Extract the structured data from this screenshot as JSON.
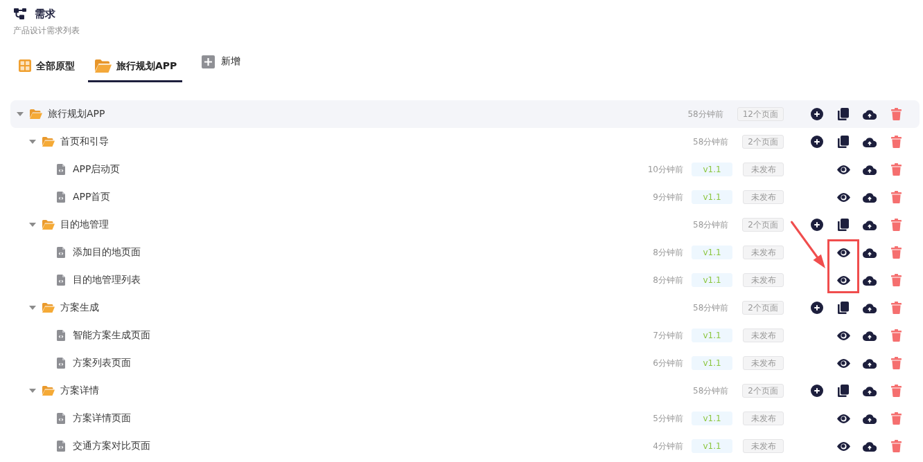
{
  "header": {
    "title": "需求",
    "subtitle": "产品设计需求列表"
  },
  "tabs": [
    {
      "label": "全部原型",
      "kind": "grid",
      "selected": false
    },
    {
      "label": "旅行规划APP",
      "kind": "folder",
      "selected": true
    }
  ],
  "add_button": {
    "label": "新增"
  },
  "tree": [
    {
      "kind": "folder",
      "name": "旅行规划APP",
      "expanded": true,
      "time": "58分钟前",
      "pages": "12个页面",
      "children": [
        {
          "kind": "folder",
          "name": "首页和引导",
          "expanded": true,
          "time": "58分钟前",
          "pages": "2个页面",
          "children": [
            {
              "kind": "file",
              "name": "APP启动页",
              "time": "10分钟前",
              "version": "v1.1",
              "status": "未发布"
            },
            {
              "kind": "file",
              "name": "APP首页",
              "time": "9分钟前",
              "version": "v1.1",
              "status": "未发布"
            }
          ]
        },
        {
          "kind": "folder",
          "name": "目的地管理",
          "expanded": true,
          "time": "58分钟前",
          "pages": "2个页面",
          "children": [
            {
              "kind": "file",
              "name": "添加目的地页面",
              "time": "8分钟前",
              "version": "v1.1",
              "status": "未发布"
            },
            {
              "kind": "file",
              "name": "目的地管理列表",
              "time": "8分钟前",
              "version": "v1.1",
              "status": "未发布"
            }
          ]
        },
        {
          "kind": "folder",
          "name": "方案生成",
          "expanded": true,
          "time": "58分钟前",
          "pages": "2个页面",
          "children": [
            {
              "kind": "file",
              "name": "智能方案生成页面",
              "time": "7分钟前",
              "version": "v1.1",
              "status": "未发布"
            },
            {
              "kind": "file",
              "name": "方案列表页面",
              "time": "6分钟前",
              "version": "v1.1",
              "status": "未发布"
            }
          ]
        },
        {
          "kind": "folder",
          "name": "方案详情",
          "expanded": true,
          "time": "58分钟前",
          "pages": "2个页面",
          "children": [
            {
              "kind": "file",
              "name": "方案详情页面",
              "time": "5分钟前",
              "version": "v1.1",
              "status": "未发布"
            },
            {
              "kind": "file",
              "name": "交通方案对比页面",
              "time": "4分钟前",
              "version": "v1.1",
              "status": "未发布"
            }
          ]
        }
      ]
    }
  ]
}
